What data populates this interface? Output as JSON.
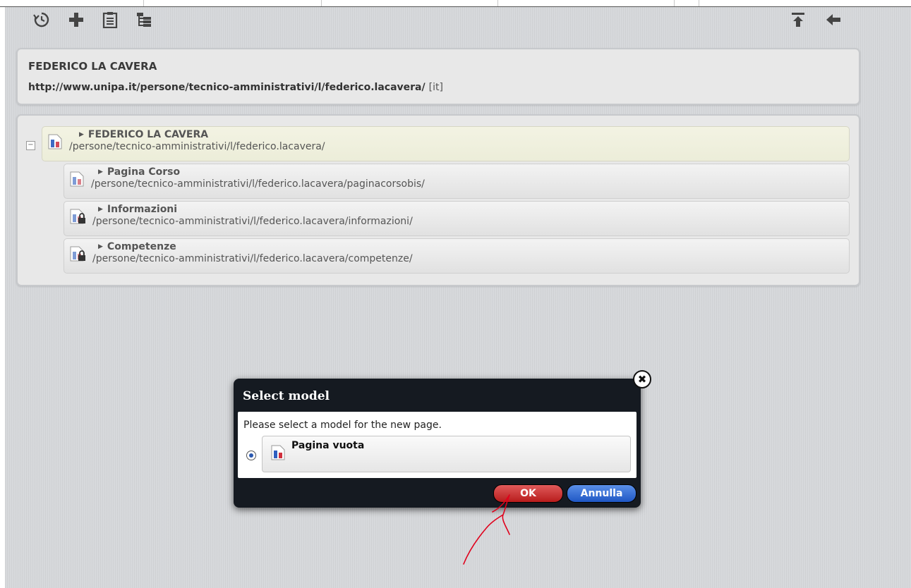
{
  "toolbar": {
    "left_icons": [
      "history-icon",
      "add-icon",
      "clipboard-icon",
      "tree-icon"
    ],
    "right_icons": [
      "move-top-icon",
      "back-arrow-icon"
    ]
  },
  "info": {
    "title": "FEDERICO LA CAVERA",
    "url": "http://www.unipa.it/persone/tecnico-amministrativi/l/federico.lacavera/",
    "lang": "[it]"
  },
  "tree": {
    "root": {
      "name": "FEDERICO LA CAVERA",
      "path": "/persone/tecnico-amministrativi/l/federico.lacavera/"
    },
    "children": [
      {
        "name": "Pagina Corso",
        "path": "/persone/tecnico-amministrativi/l/federico.lacavera/paginacorsobis/",
        "locked": false
      },
      {
        "name": "Informazioni",
        "path": "/persone/tecnico-amministrativi/l/federico.lacavera/informazioni/",
        "locked": true
      },
      {
        "name": "Competenze",
        "path": "/persone/tecnico-amministrativi/l/federico.lacavera/competenze/",
        "locked": true
      }
    ]
  },
  "dialog": {
    "title": "Select model",
    "message": "Please select a model for the new page.",
    "option": "Pagina vuota",
    "ok_label": "OK",
    "cancel_label": "Annulla",
    "close_glyph": "✖"
  },
  "colors": {
    "ok_button": "#c62a2a",
    "cancel_button": "#2f66d0",
    "annotation_arrow": "#e0001b"
  }
}
